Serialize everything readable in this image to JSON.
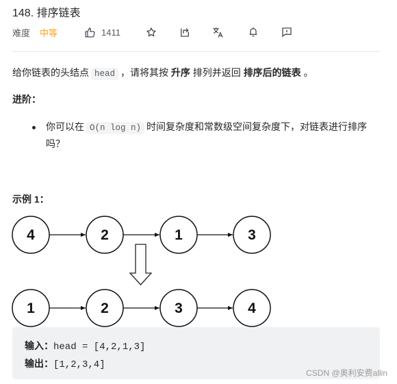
{
  "problem": {
    "title": "148. 排序链表",
    "difficulty_label": "难度",
    "difficulty": "中等",
    "likes": "1411"
  },
  "toolbar": {
    "icons": [
      "thumbs-up-icon",
      "star-icon",
      "share-icon",
      "translate-icon",
      "bell-icon",
      "feedback-icon"
    ]
  },
  "description": {
    "part1": "给你链表的头结点",
    "code_head": "head",
    "part2": "，请将其按",
    "bold1": "升序",
    "part3": "排列并返回",
    "bold2": "排序后的链表",
    "part4": "。"
  },
  "advanced": {
    "heading": "进阶：",
    "bullet_part1": "你可以在",
    "bullet_code": "O(n log n)",
    "bullet_part2": "时间复杂度和常数级空间复杂度下，对链表进行排序吗？"
  },
  "example": {
    "title": "示例 1：",
    "input_nodes": [
      "4",
      "2",
      "1",
      "3"
    ],
    "output_nodes": [
      "1",
      "2",
      "3",
      "4"
    ],
    "input_label": "输入：",
    "input_value": "head = [4,2,1,3]",
    "output_label": "输出：",
    "output_value": "[1,2,3,4]"
  },
  "watermark": "CSDN @奥利安费allin",
  "colors": {
    "difficulty_medium": "#ffa116",
    "code_bg": "#f0f1f3"
  }
}
